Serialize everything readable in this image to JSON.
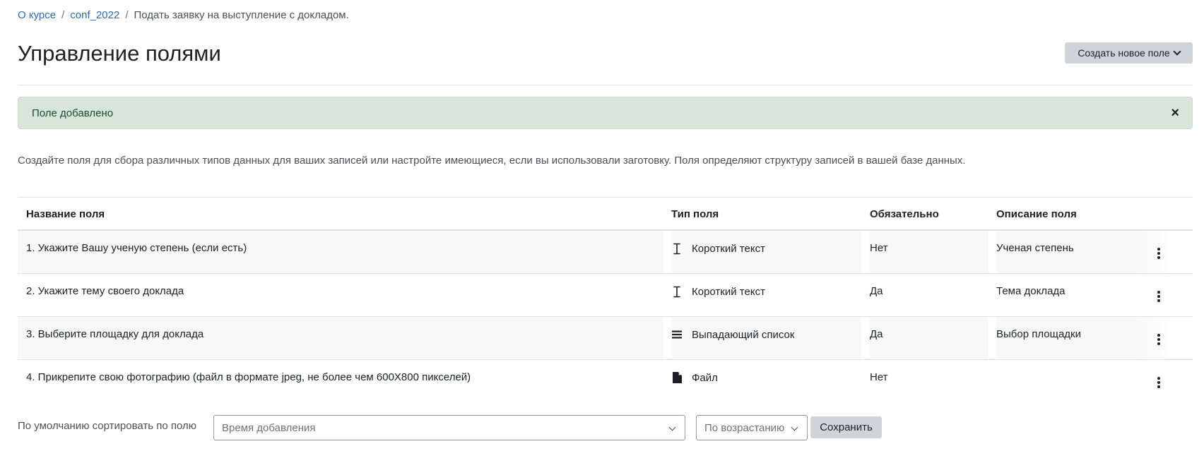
{
  "breadcrumb": {
    "items": [
      "О курсе",
      "conf_2022",
      "Подать заявку на выступление с докладом."
    ],
    "separator": "/"
  },
  "page_title": "Управление полями",
  "create_button_label": "Создать новое поле",
  "alert": {
    "text": "Поле добавлено",
    "close_symbol": "×"
  },
  "description": "Создайте поля для сбора различных типов данных для ваших записей или настройте имеющиеся, если вы использовали заготовку. Поля определяют структуру записей в вашей базе данных.",
  "table": {
    "headers": {
      "name": "Название поля",
      "type": "Тип поля",
      "required": "Обязательно",
      "description": "Описание поля"
    },
    "rows": [
      {
        "name": "1. Укажите Вашу ученую степень (если есть)",
        "type": "Короткий текст",
        "type_icon": "text-cursor-icon",
        "required": "Нет",
        "description": "Ученая степень"
      },
      {
        "name": "2. Укажите тему своего доклада",
        "type": "Короткий текст",
        "type_icon": "text-cursor-icon",
        "required": "Да",
        "description": "Тема доклада"
      },
      {
        "name": "3. Выберите площадку для доклада",
        "type": "Выпадающий список",
        "type_icon": "list-icon",
        "required": "Да",
        "description": "Выбор площадки"
      },
      {
        "name": "4. Прикрепите свою фотографию (файл в формате jpeg, не более чем 600X800 пикселей)",
        "type": "Файл",
        "type_icon": "file-icon",
        "required": "Нет",
        "description": ""
      }
    ]
  },
  "sort": {
    "label": "По умолчанию сортировать по полю",
    "field_value": "Время добавления",
    "order_value": "По возрастанию",
    "save_label": "Сохранить"
  },
  "colors": {
    "link": "#2e6aa5",
    "alert_bg": "#d7e6d8",
    "button_bg": "#ced4da",
    "stripe": "#f8f8f8"
  }
}
